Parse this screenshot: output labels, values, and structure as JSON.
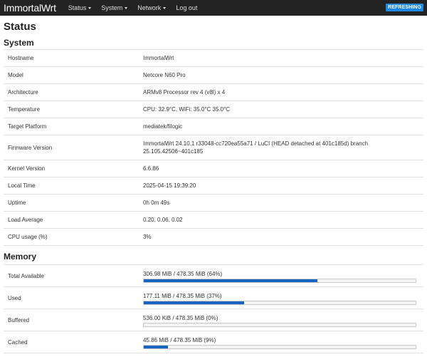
{
  "navbar": {
    "brand": "ImmortalWrt",
    "menu": [
      {
        "label": "Status",
        "dropdown": true
      },
      {
        "label": "System",
        "dropdown": true
      },
      {
        "label": "Network",
        "dropdown": true
      },
      {
        "label": "Log out",
        "dropdown": false
      }
    ],
    "badge": "REFRESHING"
  },
  "page_title": "Status",
  "system": {
    "title": "System",
    "rows": [
      {
        "key": "Hostname",
        "value": "ImmortalWrt"
      },
      {
        "key": "Model",
        "value": "Netcore N60 Pro"
      },
      {
        "key": "Architecture",
        "value": "ARMv8 Processor rev 4 (v8l) x 4"
      },
      {
        "key": "Temperature",
        "value": "CPU: 32.9°C, WiFi: 35.0°C 35.0°C"
      },
      {
        "key": "Target Platform",
        "value": "mediatek/filogic"
      },
      {
        "key": "Firmware Version",
        "value": "ImmortalWrt 24.10.1 r33048-cc720ea55a71 / LuCI (HEAD detached at 401c185d) branch 25.105.42506~401c185"
      },
      {
        "key": "Kernel Version",
        "value": "6.6.86"
      },
      {
        "key": "Local Time",
        "value": "2025-04-15 19:39:20"
      },
      {
        "key": "Uptime",
        "value": "0h 0m 49s"
      },
      {
        "key": "Load Average",
        "value": "0.20, 0.06, 0.02"
      },
      {
        "key": "CPU usage (%)",
        "value": "3%"
      }
    ]
  },
  "memory": {
    "title": "Memory",
    "rows": [
      {
        "key": "Total Available",
        "value": "306.98 MiB / 478.35 MiB (64%)",
        "percent": 64
      },
      {
        "key": "Used",
        "value": "177.11 MiB / 478.35 MiB (37%)",
        "percent": 37
      },
      {
        "key": "Buffered",
        "value": "536.00 KiB / 478.35 MiB (0%)",
        "percent": 0
      },
      {
        "key": "Cached",
        "value": "45.86 MiB / 478.35 MiB (9%)",
        "percent": 9
      }
    ]
  },
  "colors": {
    "navbar_bg": "#232323",
    "badge_bg": "#1e88e5",
    "progress_fill": "#1565c0"
  }
}
